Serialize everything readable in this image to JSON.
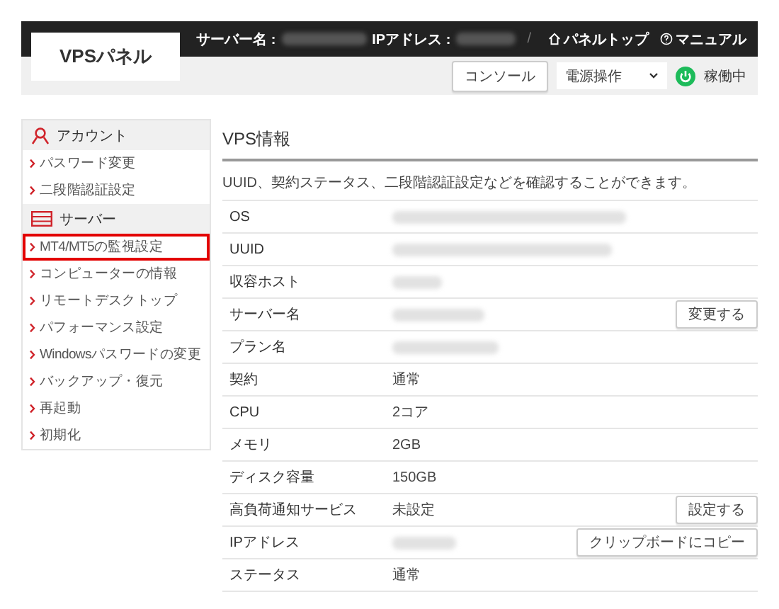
{
  "header": {
    "logo": "VPSパネル",
    "server_name_label": "サーバー名 :",
    "ip_label": "IPアドレス :",
    "separator": "/",
    "links": [
      {
        "kind": "home",
        "label": "パネルトップ"
      },
      {
        "kind": "help",
        "label": "マニュアル"
      }
    ]
  },
  "toolbar": {
    "console_button": "コンソール",
    "power_select": "電源操作",
    "status": "稼働中"
  },
  "sidebar": {
    "sections": [
      {
        "kind": "account",
        "title": "アカウント",
        "items": [
          {
            "label": "パスワード変更",
            "selected": false
          },
          {
            "label": "二段階認証設定",
            "selected": false
          }
        ]
      },
      {
        "kind": "server",
        "title": "サーバー",
        "items": [
          {
            "label": "MT4/MT5の監視設定",
            "selected": true
          },
          {
            "label": "コンピューターの情報",
            "selected": false
          },
          {
            "label": "リモートデスクトップ",
            "selected": false
          },
          {
            "label": "パフォーマンス設定",
            "selected": false
          },
          {
            "label": "Windowsパスワードの変更",
            "selected": false
          },
          {
            "label": "バックアップ・復元",
            "selected": false
          },
          {
            "label": "再起動",
            "selected": false
          },
          {
            "label": "初期化",
            "selected": false
          }
        ]
      }
    ]
  },
  "main": {
    "title": "VPS情報",
    "description": "UUID、契約ステータス、二段階認証設定などを確認することができます。",
    "rows": [
      {
        "label": "OS",
        "kind": "redacted"
      },
      {
        "label": "UUID",
        "kind": "redacted"
      },
      {
        "label": "収容ホスト",
        "kind": "redacted"
      },
      {
        "label": "サーバー名",
        "kind": "redacted",
        "button": "変更する"
      },
      {
        "label": "プラン名",
        "kind": "redacted"
      },
      {
        "label": "契約",
        "kind": "text",
        "value": "通常"
      },
      {
        "label": "CPU",
        "kind": "text",
        "value": "2コア"
      },
      {
        "label": "メモリ",
        "kind": "text",
        "value": "2GB"
      },
      {
        "label": "ディスク容量",
        "kind": "text",
        "value": "150GB"
      },
      {
        "label": "高負荷通知サービス",
        "kind": "text",
        "value": "未設定",
        "button": "設定する"
      },
      {
        "label": "IPアドレス",
        "kind": "redacted",
        "button": "クリップボードにコピー"
      },
      {
        "label": "ステータス",
        "kind": "text",
        "value": "通常"
      }
    ]
  }
}
